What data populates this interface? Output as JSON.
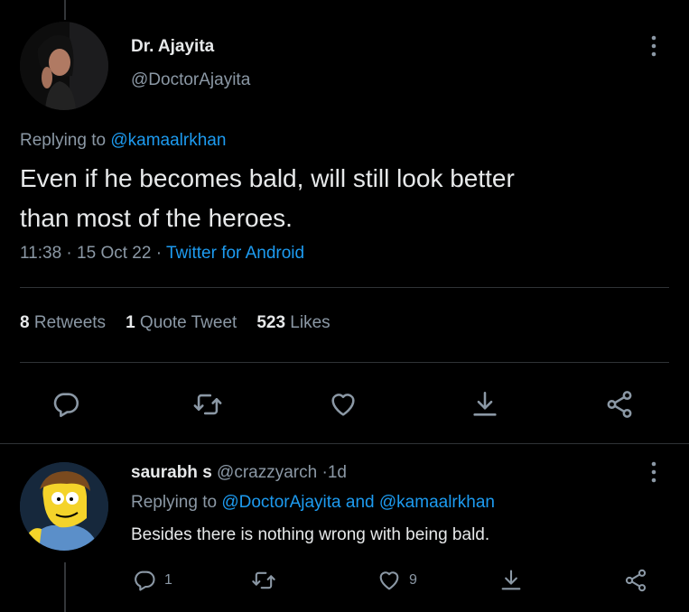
{
  "main_tweet": {
    "author_name": "Dr. Ajayita",
    "author_handle": "@DoctorAjayita",
    "replying_prefix": "Replying to",
    "replying_to": "@kamaalrkhan",
    "text_line1": "Even if he becomes bald, will still look better",
    "text_line2": "than most of the heroes.",
    "time": "11:38",
    "date": "15 Oct 22",
    "separator": "·",
    "source": "Twitter for Android",
    "retweets_count": "8",
    "retweets_label": "Retweets",
    "quotes_count": "1",
    "quotes_label": "Quote Tweet",
    "likes_count": "523",
    "likes_label": "Likes"
  },
  "reply_tweet": {
    "author_name": "saurabh s",
    "author_handle": "@crazzyarch",
    "separator": "·",
    "time": "1d",
    "replying_prefix": "Replying to",
    "replying_to_1": "@DoctorAjayita",
    "replying_and": "and",
    "replying_to_2": "@kamaalrkhan",
    "text": "Besides there is nothing wrong with being bald.",
    "reply_count": "1",
    "like_count": "9"
  },
  "icons": {
    "reply": "reply-icon",
    "retweet": "retweet-icon",
    "like": "heart-icon",
    "bookmark": "bookmark-icon",
    "share": "share-icon",
    "more": "more-icon"
  },
  "colors": {
    "background": "#000000",
    "text": "#e7e9ea",
    "secondary": "#8b98a5",
    "link": "#1d9bf0",
    "divider": "#2f3336"
  }
}
